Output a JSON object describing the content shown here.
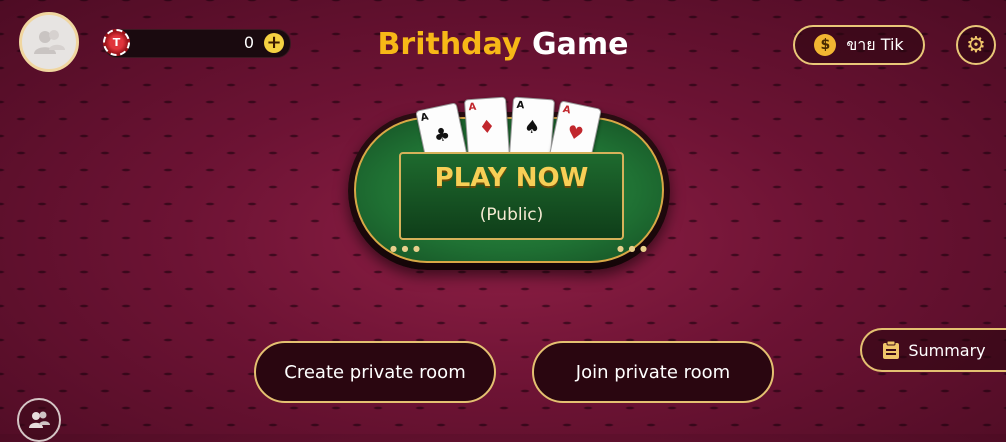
{
  "header": {
    "coin_chip_letter": "T",
    "coin_value": "0",
    "add_coins_symbol": "+",
    "title_part1": "Brithday",
    "title_part2": "Game",
    "sell_label": "ขาย Tik",
    "sell_icon_symbol": "$",
    "settings_icon_symbol": "⚙"
  },
  "table": {
    "cards": [
      {
        "rank": "A",
        "suit": "♣",
        "color": "#111111"
      },
      {
        "rank": "A",
        "suit": "♦",
        "color": "#c1272d"
      },
      {
        "rank": "A",
        "suit": "♠",
        "color": "#111111"
      },
      {
        "rank": "A",
        "suit": "♥",
        "color": "#c1272d"
      }
    ],
    "play_label": "PLAY NOW",
    "play_sublabel": "(Public)"
  },
  "buttons": {
    "create_room": "Create private room",
    "join_room": "Join private room",
    "summary": "Summary"
  },
  "colors": {
    "accent_gold": "#f7b817",
    "border_gold": "#e4c071",
    "felt_green": "#1f7033",
    "background": "#6d1334"
  }
}
